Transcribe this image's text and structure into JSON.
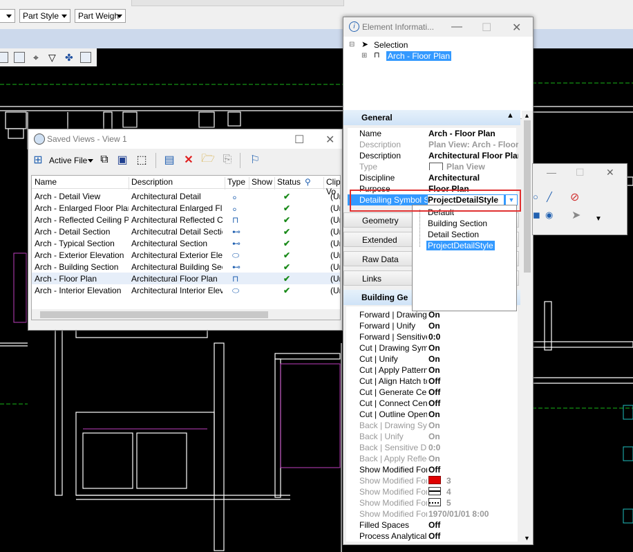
{
  "toolbar": {
    "combo1": "Part Style",
    "combo2": "Part Weigh"
  },
  "saved_views": {
    "title": "Saved Views - View 1",
    "active_file_label": "Active File",
    "columns": [
      "Name",
      "Description",
      "Type",
      "Show",
      "Status",
      "Clip Vo"
    ],
    "rows": [
      {
        "name": "Arch - Detail View",
        "description": "Architectural Detail",
        "type_icon": "detail-type-icon",
        "clip": "(Unt"
      },
      {
        "name": "Arch - Enlarged Floor Plan",
        "description": "Architectural Enlarged Fl...",
        "type_icon": "detail-type-icon",
        "clip": "(Unt"
      },
      {
        "name": "Arch - Reflected Ceiling Plan",
        "description": "Architectural Reflected C...",
        "type_icon": "plan-type-icon",
        "clip": "(Unt"
      },
      {
        "name": "Arch - Detail Section",
        "description": "Architecutral Detail Section",
        "type_icon": "section-type-icon",
        "clip": "(Unt"
      },
      {
        "name": "Arch - Typical Section",
        "description": "Architectural Section",
        "type_icon": "section-type-icon",
        "clip": "(Unt"
      },
      {
        "name": "Arch - Exterior Elevation",
        "description": "Architectural Exterior Ele...",
        "type_icon": "elevation-type-icon",
        "clip": "(Unt"
      },
      {
        "name": "Arch - Building Section",
        "description": "Architectural Building Sec...",
        "type_icon": "section-type-icon",
        "clip": "(Unt"
      },
      {
        "name": "Arch - Floor Plan",
        "description": "Architectural Floor Plan",
        "type_icon": "plan-type-icon",
        "clip": "(Unt",
        "selected": true
      },
      {
        "name": "Arch - Interior Elevation",
        "description": "Architectural Interior Elev...",
        "type_icon": "elevation-type-icon",
        "clip": "(Unt"
      }
    ]
  },
  "element_info": {
    "title": "Element Informati...",
    "tree_root": "Selection",
    "tree_child": "Arch - Floor Plan",
    "section_general": "General",
    "general_rows": [
      {
        "k": "Name",
        "v": "Arch - Floor Plan"
      },
      {
        "k": "Description",
        "v": "Plan View: Arch - Floor Plan",
        "dim": true
      },
      {
        "k": "Description",
        "v": "Architectural Floor Plan"
      },
      {
        "k": "Type",
        "v": "Plan View",
        "dim": true
      },
      {
        "k": "Discipline",
        "v": "Architectural"
      },
      {
        "k": "Purpose",
        "v": "Floor Plan"
      }
    ],
    "selected_row": {
      "k": "Detailing Symbol Style",
      "v": "ProjectDetailStyle"
    },
    "sections": [
      "Geometry",
      "Extended",
      "Raw Data",
      "Links"
    ],
    "section_building": "Building Ge",
    "building_rows": [
      {
        "k": "Forward | Drawing",
        "v": "On"
      },
      {
        "k": "Forward | Unify",
        "v": "On"
      },
      {
        "k": "Forward | Sensitive",
        "v": "0:0"
      },
      {
        "k": "Cut | Drawing Symb",
        "v": "On"
      },
      {
        "k": "Cut | Unify",
        "v": "On"
      },
      {
        "k": "Cut | Apply Patterns",
        "v": "On"
      },
      {
        "k": "Cut | Align Hatch to",
        "v": "Off"
      },
      {
        "k": "Cut | Generate Cen",
        "v": "Off"
      },
      {
        "k": "Cut | Connect Cente",
        "v": "Off"
      },
      {
        "k": "Cut | Outline Openi",
        "v": "On"
      },
      {
        "k": "Back | Drawing Syn",
        "v": "On",
        "dim": true
      },
      {
        "k": "Back | Unify",
        "v": "On",
        "dim": true
      },
      {
        "k": "Back | Sensitive Di",
        "v": "0:0",
        "dim": true
      },
      {
        "k": "Back | Apply Reflec",
        "v": "On",
        "dim": true
      },
      {
        "k": "Show Modified Forr",
        "v": "Off"
      },
      {
        "k": "Show Modified Forr",
        "v": "3",
        "dim": true,
        "swatch": "red"
      },
      {
        "k": "Show Modified Forr",
        "v": "4",
        "dim": true,
        "swatch": "solid"
      },
      {
        "k": "Show Modified Forr",
        "v": "5",
        "dim": true,
        "swatch": "dotted"
      },
      {
        "k": "Show Modified Forr",
        "v": "1970/01/01 8:00",
        "dim": true
      },
      {
        "k": "Filled Spaces",
        "v": "Off"
      },
      {
        "k": "Process Analytical",
        "v": "Off"
      }
    ]
  },
  "dropdown": {
    "options": [
      "Default",
      "Building Section",
      "Detail Section",
      "ProjectDetailStyle"
    ],
    "selected_index": 3
  },
  "colors": {
    "accent": "#3399ff",
    "highlight_box": "#e03030",
    "header_blue": "#cfe3f7",
    "cad_green": "#18b818",
    "cad_magenta": "#c040c0"
  }
}
